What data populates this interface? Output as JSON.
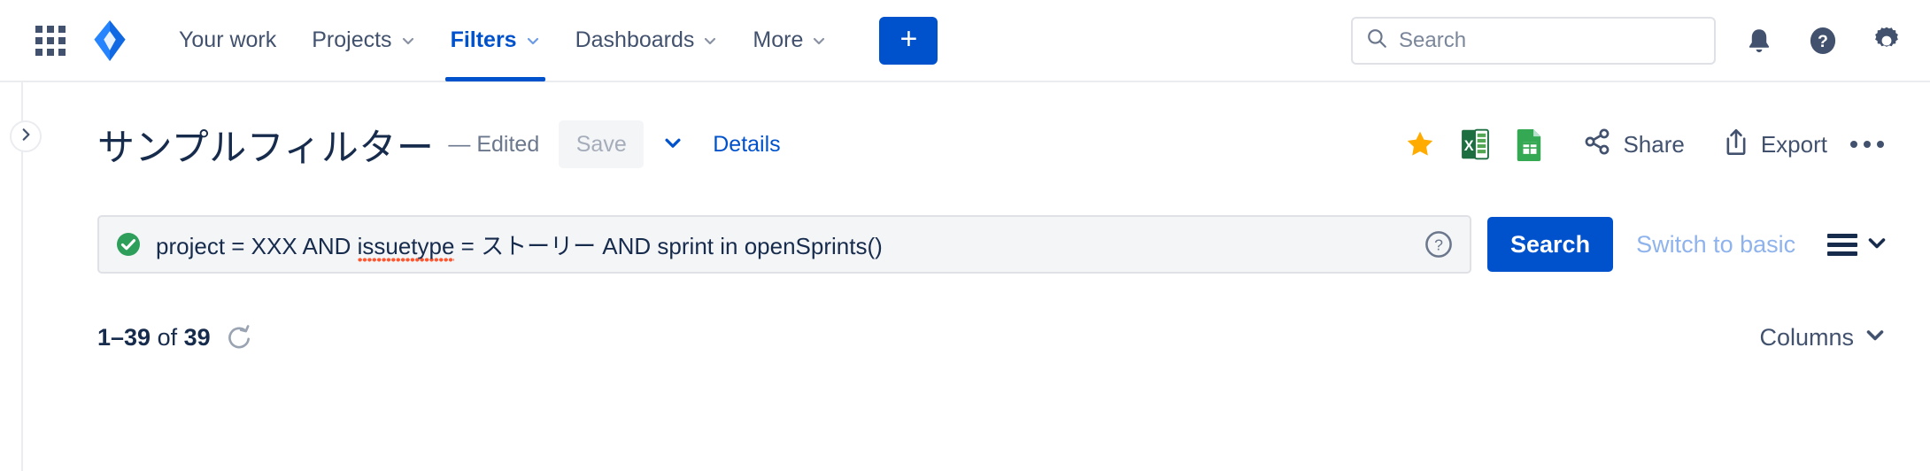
{
  "topnav": {
    "app_switcher_icon": "grid-apps-icon",
    "logo_icon": "jira-logo-icon",
    "items": [
      {
        "label": "Your work",
        "has_caret": false,
        "active": false
      },
      {
        "label": "Projects",
        "has_caret": true,
        "active": false
      },
      {
        "label": "Filters",
        "has_caret": true,
        "active": true
      },
      {
        "label": "Dashboards",
        "has_caret": true,
        "active": false
      },
      {
        "label": "More",
        "has_caret": true,
        "active": false
      }
    ],
    "create_button_label": "+",
    "search": {
      "placeholder": "Search",
      "value": "",
      "icon": "search-icon"
    },
    "right_icons": [
      {
        "name": "notifications-bell-icon"
      },
      {
        "name": "help-question-icon"
      },
      {
        "name": "settings-gear-icon"
      }
    ]
  },
  "left_rail": {
    "toggle_icon": "chevron-right-icon"
  },
  "header": {
    "title": "サンプルフィルター",
    "edited_label": "— Edited",
    "save_label": "Save",
    "save_caret_icon": "chevron-down-icon",
    "details_label": "Details",
    "actions": {
      "star_icon": "star-filled-icon",
      "excel_icon": "excel-export-icon",
      "sheets_icon": "google-sheets-export-icon",
      "share_label": "Share",
      "share_icon": "share-icon",
      "export_label": "Export",
      "export_icon": "export-upload-icon",
      "more_icon": "more-horizontal-icon"
    }
  },
  "jql": {
    "status_icon": "valid-check-icon",
    "query_part1": "project = XXX AND ",
    "query_highlight": "issuetype",
    "query_part2": " = ストーリー AND sprint in openSprints()",
    "full_query": "project = XXX AND issuetype = ストーリー AND sprint in openSprints()",
    "help_icon": "help-circle-icon",
    "search_button_label": "Search",
    "switch_label": "Switch to basic",
    "view_toggle_icon": "list-view-icon",
    "view_toggle_caret_icon": "chevron-down-icon"
  },
  "results": {
    "range_start": "1–39",
    "of_label": " of ",
    "total": "39",
    "refresh_icon": "refresh-icon",
    "columns_label": "Columns",
    "columns_caret_icon": "chevron-down-icon"
  },
  "colors": {
    "brand_blue": "#0052cc",
    "text_dark": "#172b4d",
    "text_muted": "#6b778c",
    "star_orange": "#ffab00",
    "excel_green": "#1d6f42",
    "valid_green": "#36b37e",
    "squiggle_red": "#ff5630",
    "border": "#dfe1e6"
  }
}
